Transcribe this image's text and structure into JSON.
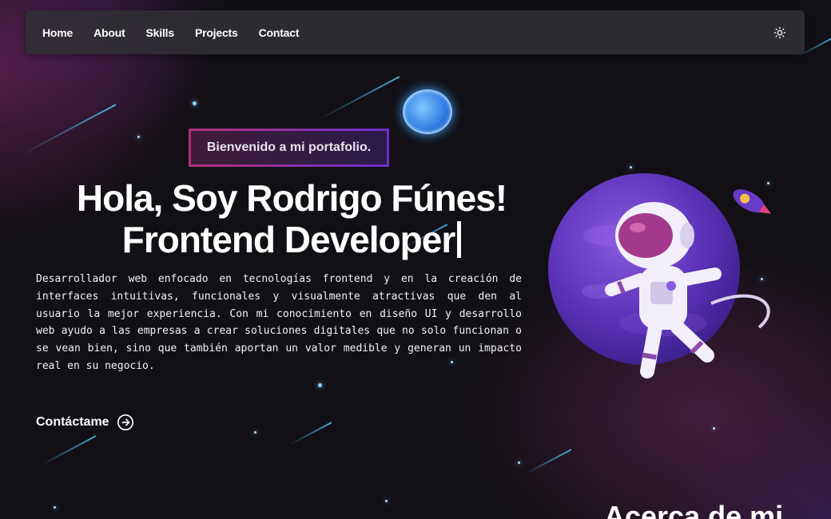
{
  "nav": {
    "links": [
      "Home",
      "About",
      "Skills",
      "Projects",
      "Contact"
    ],
    "theme_icon": "sun-icon"
  },
  "hero": {
    "badge": "Bienvenido a mi portafolio.",
    "title_line1": "Hola, Soy Rodrigo Fúnes!",
    "title_line2": "Frontend Developer",
    "description": "Desarrollador web enfocado en tecnologías frontend y en la creación de interfaces intuitivas, funcionales y visualmente atractivas que den al usuario la mejor experiencia. Con mi conocimiento en diseño UI y desarrollo web ayudo a las empresas a crear soluciones digitales que no solo funcionan o se vean bien, sino que también aportan un valor medible y generan un impacto real en su negocio.",
    "cta_label": "Contáctame",
    "cta_icon": "arrow-right-circle-icon"
  },
  "next_section": {
    "heading": "Acerca de mi"
  },
  "colors": {
    "accent_pink": "#b0307a",
    "accent_purple": "#6a30c8",
    "background": "#121015",
    "nav_bg": "#302e34"
  }
}
